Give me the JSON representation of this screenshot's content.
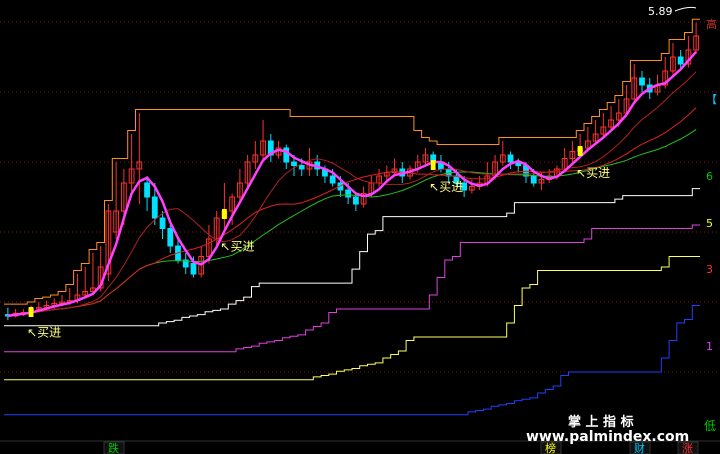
{
  "chart_data": {
    "type": "candlestick",
    "title": "",
    "max_label": "5.89",
    "y_range": [
      0.1,
      6.1
    ],
    "grid": "dotted horizontal",
    "candles": [
      [
        1.72,
        1.7,
        1.64,
        1.82
      ],
      [
        1.7,
        1.74,
        1.68,
        1.8
      ],
      [
        1.74,
        1.75,
        1.7,
        1.8
      ],
      [
        1.75,
        1.8,
        1.72,
        1.85
      ],
      [
        1.8,
        1.82,
        1.76,
        1.9
      ],
      [
        1.82,
        1.85,
        1.78,
        1.92
      ],
      [
        1.85,
        1.88,
        1.8,
        1.95
      ],
      [
        1.88,
        1.9,
        1.84,
        2.0
      ],
      [
        1.9,
        1.92,
        1.86,
        2.1
      ],
      [
        1.92,
        2.0,
        1.88,
        2.3
      ],
      [
        2.0,
        2.05,
        1.95,
        2.4
      ],
      [
        2.05,
        2.1,
        2.0,
        2.6
      ],
      [
        2.1,
        2.4,
        2.05,
        2.7
      ],
      [
        2.3,
        3.2,
        2.2,
        3.3
      ],
      [
        2.9,
        3.2,
        2.8,
        3.9
      ],
      [
        3.2,
        3.6,
        3.0,
        3.8
      ],
      [
        3.6,
        3.8,
        3.4,
        4.3
      ],
      [
        3.8,
        3.9,
        3.3,
        4.6
      ],
      [
        3.6,
        3.4,
        3.2,
        3.7
      ],
      [
        3.4,
        3.1,
        3.0,
        3.6
      ],
      [
        3.1,
        2.95,
        2.8,
        3.2
      ],
      [
        2.95,
        2.7,
        2.6,
        3.0
      ],
      [
        2.7,
        2.5,
        2.45,
        2.8
      ],
      [
        2.5,
        2.4,
        2.3,
        2.6
      ],
      [
        2.45,
        2.3,
        2.25,
        2.55
      ],
      [
        2.3,
        2.55,
        2.25,
        2.7
      ],
      [
        2.55,
        2.8,
        2.45,
        3.0
      ],
      [
        2.8,
        3.1,
        2.7,
        3.2
      ],
      [
        3.1,
        3.2,
        2.95,
        3.6
      ],
      [
        3.2,
        3.4,
        3.0,
        3.45
      ],
      [
        3.4,
        3.6,
        3.3,
        3.8
      ],
      [
        3.6,
        3.9,
        3.5,
        4.0
      ],
      [
        3.9,
        4.0,
        3.8,
        4.2
      ],
      [
        4.0,
        4.2,
        3.9,
        4.5
      ],
      [
        4.2,
        4.0,
        3.9,
        4.3
      ],
      [
        4.0,
        4.1,
        3.95,
        4.2
      ],
      [
        4.1,
        3.9,
        3.8,
        4.15
      ],
      [
        3.9,
        3.85,
        3.7,
        4.0
      ],
      [
        3.85,
        3.8,
        3.7,
        3.95
      ],
      [
        3.8,
        3.9,
        3.7,
        4.1
      ],
      [
        3.9,
        3.8,
        3.7,
        4.0
      ],
      [
        3.8,
        3.7,
        3.6,
        3.85
      ],
      [
        3.7,
        3.6,
        3.55,
        3.8
      ],
      [
        3.6,
        3.5,
        3.4,
        3.7
      ],
      [
        3.5,
        3.4,
        3.3,
        3.6
      ],
      [
        3.4,
        3.3,
        3.2,
        3.45
      ],
      [
        3.3,
        3.45,
        3.25,
        3.55
      ],
      [
        3.45,
        3.6,
        3.4,
        3.7
      ],
      [
        3.6,
        3.7,
        3.55,
        3.8
      ],
      [
        3.7,
        3.75,
        3.6,
        3.85
      ],
      [
        3.75,
        3.8,
        3.7,
        3.95
      ],
      [
        3.8,
        3.7,
        3.6,
        3.9
      ],
      [
        3.7,
        3.8,
        3.65,
        3.85
      ],
      [
        3.8,
        3.9,
        3.75,
        4.0
      ],
      [
        3.9,
        4.0,
        3.85,
        4.1
      ],
      [
        4.0,
        3.9,
        3.8,
        4.05
      ],
      [
        3.9,
        3.8,
        3.75,
        4.0
      ],
      [
        3.8,
        3.7,
        3.6,
        3.9
      ],
      [
        3.7,
        3.6,
        3.55,
        3.8
      ],
      [
        3.6,
        3.5,
        3.4,
        3.7
      ],
      [
        3.5,
        3.55,
        3.45,
        3.65
      ],
      [
        3.55,
        3.6,
        3.5,
        3.7
      ],
      [
        3.6,
        3.7,
        3.55,
        3.9
      ],
      [
        3.7,
        3.9,
        3.65,
        4.0
      ],
      [
        3.9,
        4.0,
        3.85,
        4.2
      ],
      [
        4.0,
        3.9,
        3.8,
        4.05
      ],
      [
        3.9,
        3.85,
        3.75,
        3.95
      ],
      [
        3.85,
        3.7,
        3.6,
        3.9
      ],
      [
        3.7,
        3.6,
        3.55,
        3.8
      ],
      [
        3.6,
        3.65,
        3.5,
        3.75
      ],
      [
        3.65,
        3.7,
        3.6,
        3.8
      ],
      [
        3.7,
        3.8,
        3.65,
        3.85
      ],
      [
        3.8,
        3.95,
        3.75,
        4.1
      ],
      [
        3.95,
        4.05,
        3.9,
        4.2
      ],
      [
        4.05,
        4.1,
        4.0,
        4.3
      ],
      [
        4.1,
        4.2,
        4.05,
        4.4
      ],
      [
        4.2,
        4.3,
        4.15,
        4.5
      ],
      [
        4.3,
        4.4,
        4.25,
        4.6
      ],
      [
        4.4,
        4.5,
        4.35,
        4.7
      ],
      [
        4.5,
        4.6,
        4.4,
        4.8
      ],
      [
        4.6,
        4.8,
        4.55,
        5.0
      ],
      [
        4.8,
        5.1,
        4.75,
        5.3
      ],
      [
        5.1,
        5.0,
        4.9,
        5.2
      ],
      [
        5.0,
        4.9,
        4.8,
        5.1
      ],
      [
        4.9,
        5.0,
        4.85,
        5.15
      ],
      [
        5.0,
        5.2,
        4.95,
        5.4
      ],
      [
        5.2,
        5.4,
        5.15,
        5.6
      ],
      [
        5.4,
        5.3,
        5.2,
        5.5
      ],
      [
        5.3,
        5.5,
        5.25,
        5.7
      ],
      [
        5.5,
        5.7,
        5.45,
        5.89
      ]
    ],
    "signals": [
      {
        "x_index": 3,
        "label": "↖买进"
      },
      {
        "x_index": 28,
        "label": "↖买进"
      },
      {
        "x_index": 55,
        "label": "↖买进"
      },
      {
        "x_index": 74,
        "label": "↖买进"
      }
    ],
    "right_labels": [
      "高",
      "【",
      "6",
      "5",
      "3",
      "1"
    ],
    "right_label_colors": [
      "#d03030",
      "#00c8ff",
      "#00c800",
      "#ffff00",
      "#ff3030",
      "#e040ff"
    ],
    "bottom_tabs": [
      {
        "label": "跌",
        "color": "#00c800"
      },
      {
        "label": "榜",
        "color": "#ffff00"
      },
      {
        "label": "财",
        "color": "#00c8ff"
      },
      {
        "label": "涨",
        "color": "#ff3030"
      }
    ],
    "low_label": "低"
  },
  "watermark": {
    "line1": "掌 上 指 标",
    "line2": "www.palmindex.com"
  },
  "colors": {
    "background": "#000000",
    "up_candle": "#ff3030",
    "down_candle": "#00e0ff",
    "ma_main": "#ff40ff",
    "ma_red": "#e02020",
    "ma_green": "#20c020",
    "band_orange": "#ff9020",
    "band_white": "#ffffff",
    "band_magenta": "#e040e0",
    "band_yellow": "#ffff60",
    "band_blue": "#2040ff",
    "signal_text": "#ffff80"
  }
}
